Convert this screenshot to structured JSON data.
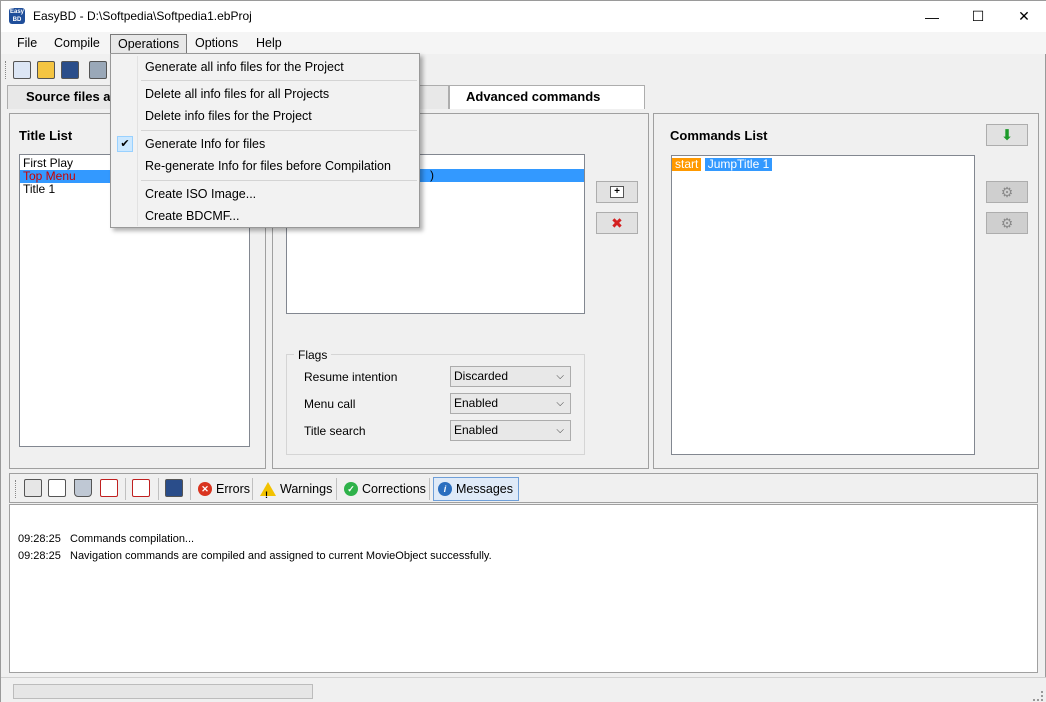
{
  "window": {
    "title": "EasyBD - D:\\Softpedia\\Softpedia1.ebProj",
    "app_icon_text": "Easy BD",
    "minimize": "—",
    "maximize": "☐",
    "close": "✕"
  },
  "menubar": {
    "items": [
      "File",
      "Compile",
      "Operations",
      "Options",
      "Help"
    ]
  },
  "dropdown": {
    "items": [
      "Generate all info files for the Project",
      "Delete all info files for all Projects",
      "Delete info files for the Project",
      "Generate Info for files",
      "Re-generate Info for files before Compilation",
      "Create ISO Image...",
      "Create BDCMF..."
    ],
    "check": "✔"
  },
  "tabs": {
    "source": "Source files a",
    "advanced": "Advanced commands"
  },
  "title_list": {
    "heading": "Title List",
    "items": [
      "First Play",
      "Top Menu",
      "Title 1"
    ]
  },
  "middle": {
    "selected_row_fragment": ")",
    "add_glyph": "+",
    "delete_glyph": "✖",
    "flags": {
      "legend": "Flags",
      "rows": [
        {
          "label": "Resume intention",
          "value": "Discarded"
        },
        {
          "label": "Menu call",
          "value": "Enabled"
        },
        {
          "label": "Title search",
          "value": "Enabled"
        }
      ]
    }
  },
  "commands_list": {
    "heading": "Commands List",
    "items": [
      "start",
      "JumpTitle 1"
    ],
    "download_glyph": "⬇",
    "gear_glyph": "⚙"
  },
  "logbar": {
    "errors": "Errors",
    "warnings": "Warnings",
    "corrections": "Corrections",
    "messages": "Messages",
    "error_glyph": "✕",
    "warning_glyph": "!",
    "correction_glyph": "✓",
    "info_glyph": "i"
  },
  "log": {
    "lines": [
      {
        "time": "09:28:25",
        "text": "Commands compilation..."
      },
      {
        "time": "09:28:25",
        "text": "Navigation commands are compiled and assigned to current MovieObject successfully."
      }
    ]
  },
  "colors": {
    "selection": "#3399ff",
    "top_menu_text": "#cc0000",
    "start_highlight": "#ff9900"
  }
}
